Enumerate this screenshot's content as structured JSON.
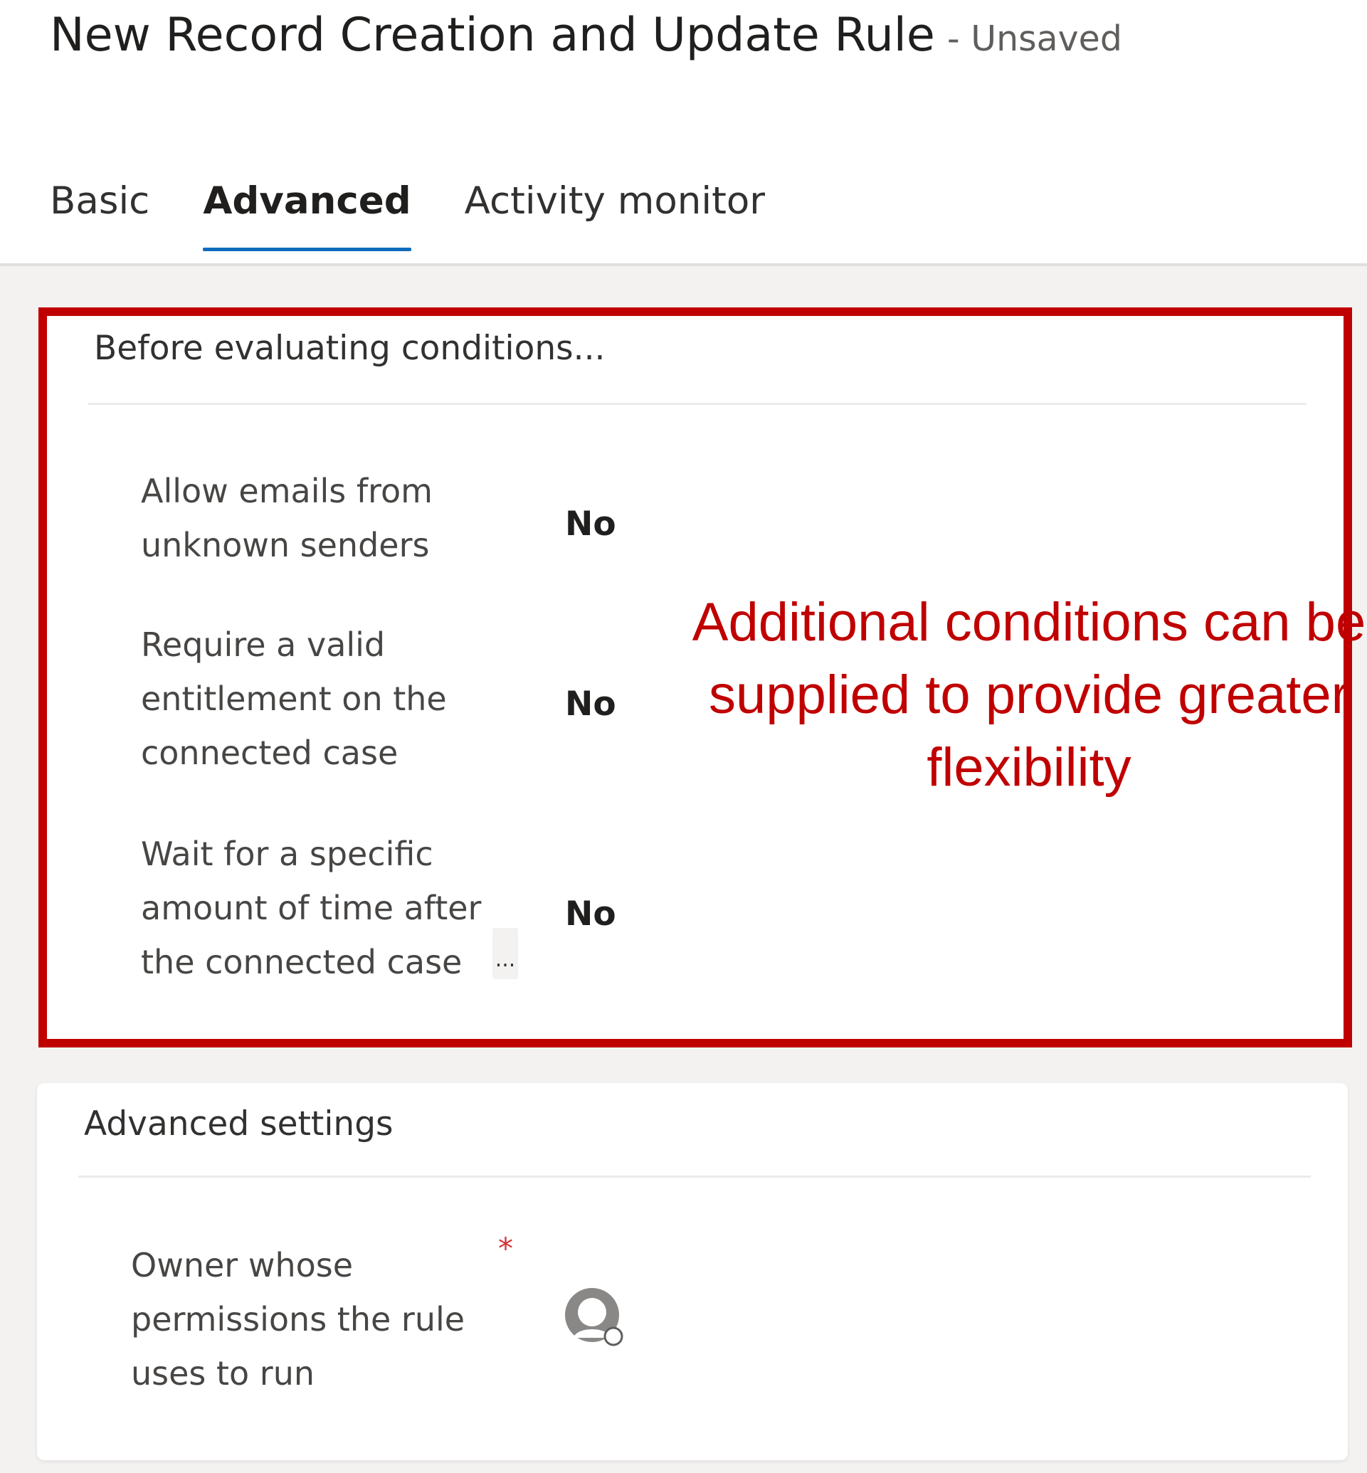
{
  "header": {
    "title": "New Record Creation and Update Rule",
    "status": "- Unsaved"
  },
  "tabs": [
    {
      "label": "Basic",
      "active": false
    },
    {
      "label": "Advanced",
      "active": true
    },
    {
      "label": "Activity monitor",
      "active": false
    }
  ],
  "conditions_section": {
    "title": "Before evaluating conditions...",
    "fields": [
      {
        "label": "Allow emails from unknown senders",
        "value": "No"
      },
      {
        "label": "Require a valid entitlement on the connected case",
        "value": "No"
      },
      {
        "label": "Wait for a specific amount of time after the connected case",
        "value": "No",
        "more": "..."
      }
    ],
    "annotation": "Additional conditions can be supplied to provide greater flexibility"
  },
  "advanced_section": {
    "title": "Advanced settings",
    "owner_field": {
      "label": "Owner whose permissions the rule uses to run",
      "required_mark": "*",
      "avatar_icon": "person-avatar-icon"
    }
  },
  "colors": {
    "accent": "#0f6cbd",
    "annotation_red": "#c00000",
    "required_red": "#d13438"
  }
}
